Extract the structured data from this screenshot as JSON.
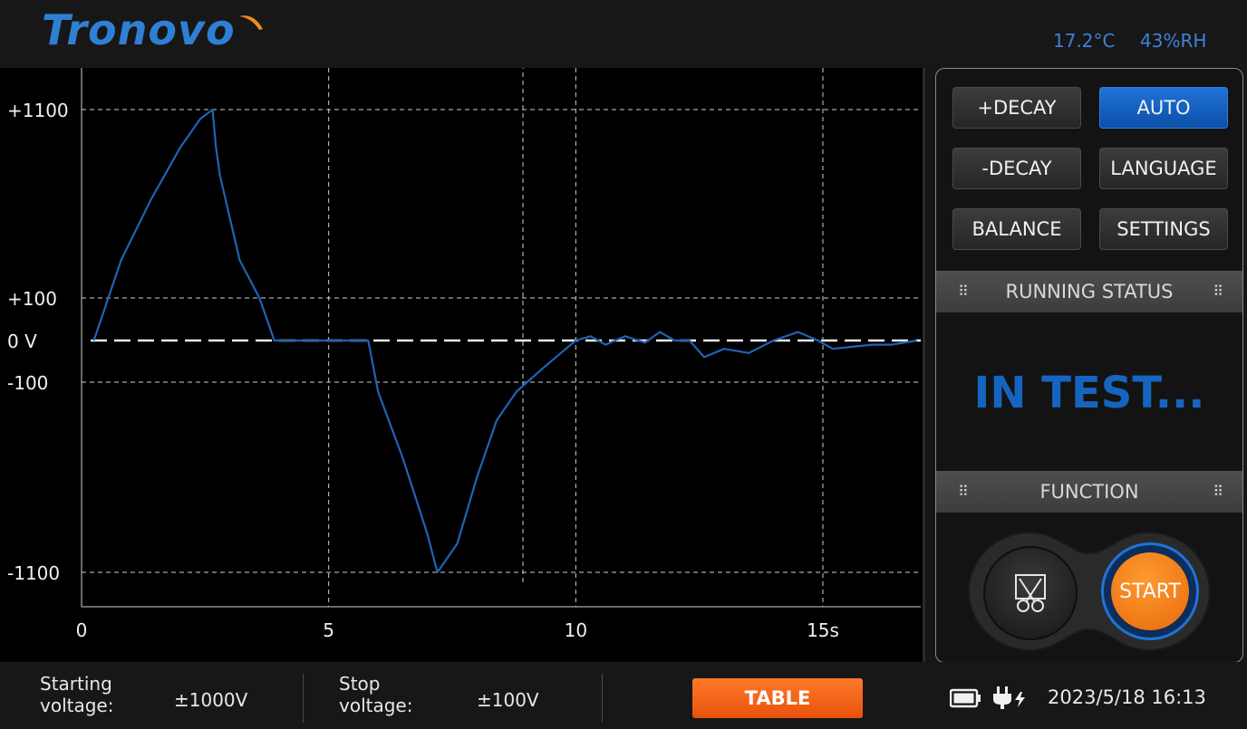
{
  "header": {
    "brand": "Tronovo",
    "temperature": "17.2°C",
    "humidity": "43%RH"
  },
  "controls": {
    "plus_decay": "+DECAY",
    "auto": "AUTO",
    "minus_decay": "-DECAY",
    "language": "LANGUAGE",
    "balance": "BALANCE",
    "settings": "SETTINGS"
  },
  "running_status": {
    "header": "RUNNING STATUS",
    "text": "IN TEST..."
  },
  "function": {
    "header": "FUNCTION",
    "start": "START"
  },
  "footer": {
    "starting_label_1": "Starting",
    "starting_label_2": "voltage:",
    "starting_value": "±1000V",
    "stop_label_1": "Stop",
    "stop_label_2": "voltage:",
    "stop_value": "±100V",
    "table_button": "TABLE",
    "datetime": "2023/5/18  16:13"
  },
  "colors": {
    "accent_blue": "#1f73d8",
    "trace": "#1e63b5",
    "orange": "#f07a1a"
  },
  "chart_data": {
    "type": "line",
    "title": "",
    "xlabel": "",
    "ylabel": "",
    "xlim": [
      0,
      17
    ],
    "ylim": [
      -1100,
      1100
    ],
    "x_ticks": [
      {
        "v": 0,
        "label": "0"
      },
      {
        "v": 5,
        "label": "5"
      },
      {
        "v": 10,
        "label": "10"
      },
      {
        "v": 15,
        "label": "15s"
      }
    ],
    "y_ticks": [
      {
        "v": 1100,
        "label": "+1100"
      },
      {
        "v": 100,
        "label": "+100"
      },
      {
        "v": 0,
        "label": "0 V"
      },
      {
        "v": -100,
        "label": "-100"
      },
      {
        "v": -1100,
        "label": "-1100"
      }
    ],
    "grid": true,
    "series": [
      {
        "x": [
          0.25,
          0.8,
          1.4,
          2.0,
          2.4,
          2.65,
          2.72,
          2.8,
          3.2,
          3.6,
          3.9,
          4.5,
          5.0,
          5.5,
          5.8,
          6.0,
          6.5,
          7.0,
          7.2,
          7.6,
          8.0,
          8.4,
          8.8,
          9.3,
          9.8,
          10.0,
          10.3,
          10.6,
          11.0,
          11.4,
          11.7,
          12.0,
          12.3,
          12.6,
          13.0,
          13.5,
          14.0,
          14.5,
          14.9,
          15.2,
          15.6,
          16.0,
          16.4,
          16.9
        ],
        "y": [
          0,
          300,
          620,
          900,
          1050,
          1100,
          900,
          750,
          300,
          100,
          0,
          0,
          0,
          0,
          0,
          -150,
          -500,
          -900,
          -1100,
          -950,
          -600,
          -300,
          -150,
          -70,
          -20,
          0,
          10,
          -10,
          10,
          -5,
          20,
          0,
          0,
          -40,
          -20,
          -30,
          0,
          20,
          0,
          -20,
          -15,
          -10,
          -10,
          0
        ]
      }
    ]
  }
}
